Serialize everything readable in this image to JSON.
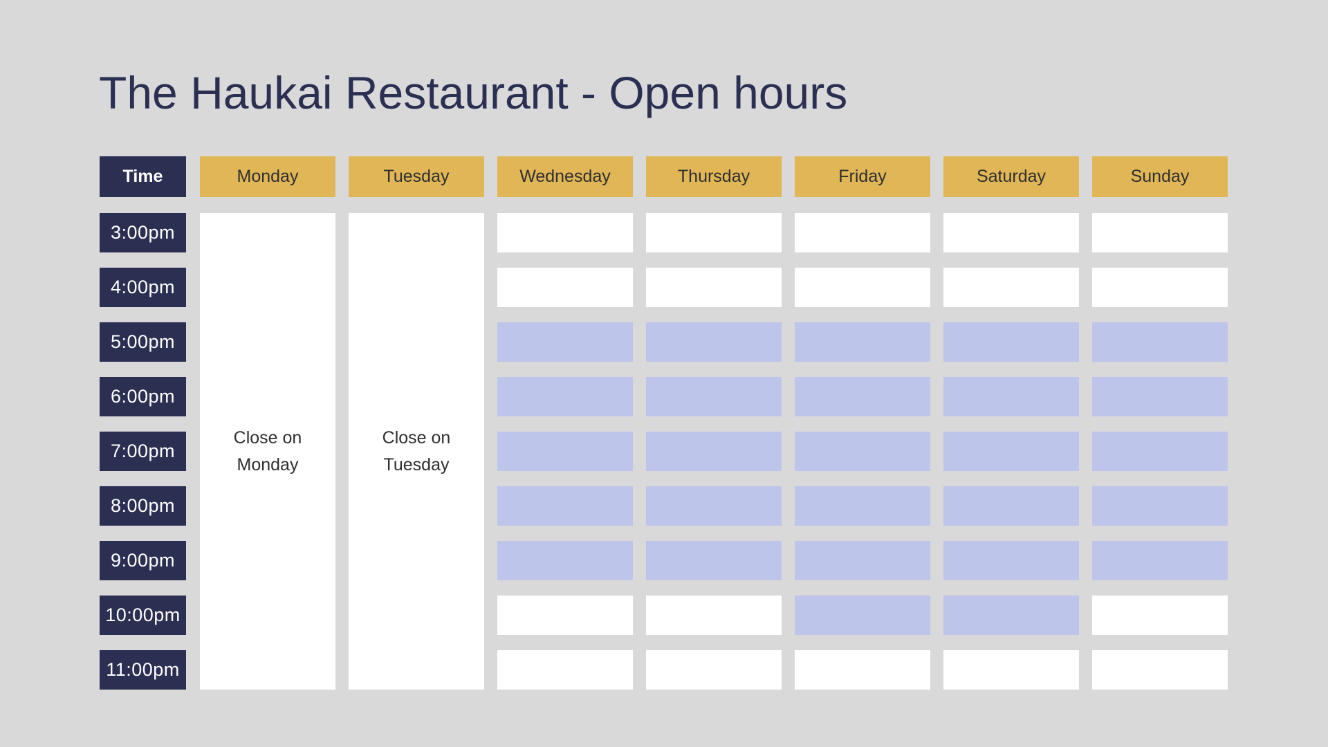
{
  "title": "The Haukai Restaurant - Open hours",
  "header": {
    "time_label": "Time"
  },
  "colors": {
    "open": "#bdc5ea",
    "closed": "#ffffff"
  },
  "days": [
    "Monday",
    "Tuesday",
    "Wednesday",
    "Thursday",
    "Friday",
    "Saturday",
    "Sunday"
  ],
  "times": [
    "3:00pm",
    "4:00pm",
    "5:00pm",
    "6:00pm",
    "7:00pm",
    "8:00pm",
    "9:00pm",
    "10:00pm",
    "11:00pm"
  ],
  "closed_days": [
    {
      "day": "Monday",
      "text": "Close on Monday"
    },
    {
      "day": "Tuesday",
      "text": "Close on Tuesday"
    }
  ],
  "schedule": {
    "Wednesday": [
      0,
      0,
      1,
      1,
      1,
      1,
      1,
      0,
      0
    ],
    "Thursday": [
      0,
      0,
      1,
      1,
      1,
      1,
      1,
      0,
      0
    ],
    "Friday": [
      0,
      0,
      1,
      1,
      1,
      1,
      1,
      1,
      0
    ],
    "Saturday": [
      0,
      0,
      1,
      1,
      1,
      1,
      1,
      1,
      0
    ],
    "Sunday": [
      0,
      0,
      1,
      1,
      1,
      1,
      1,
      0,
      0
    ]
  }
}
